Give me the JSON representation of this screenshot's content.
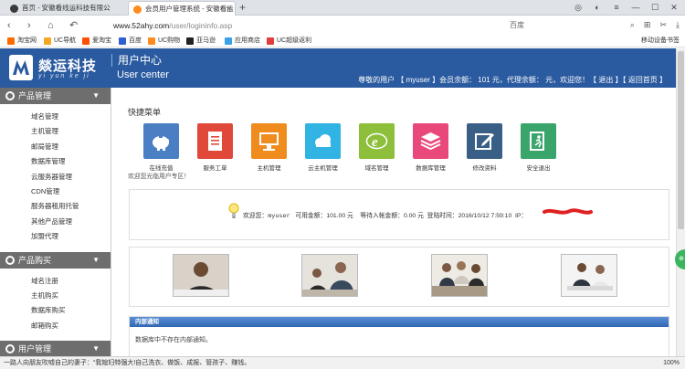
{
  "browser": {
    "tabs": [
      {
        "title": "首页 - 安徽看线运科技有限公",
        "favicon_color": "#3a3a3a",
        "active": false
      },
      {
        "title": "会员用户管理系统 - 安徽看运",
        "favicon_color": "#ff8a1f",
        "active": true
      }
    ],
    "new_tab": "+",
    "url_host": "www.52ahy.com",
    "url_path": "/user/logininfo.asp",
    "search_engine": "百度",
    "bookmarks": [
      {
        "label": "淘宝网",
        "color": "#ff6a00"
      },
      {
        "label": "UC导航",
        "color": "#f5a623"
      },
      {
        "label": "爱淘宝",
        "color": "#ff5000"
      },
      {
        "label": "百度",
        "color": "#2f5fd0"
      },
      {
        "label": "UC购物",
        "color": "#ff8a1f"
      },
      {
        "label": "亚马逊",
        "color": "#222222"
      },
      {
        "label": "应用商店",
        "color": "#3aa0e8"
      },
      {
        "label": "UC超级返利",
        "color": "#e23c3c"
      }
    ],
    "bookmark_right": "移动设备书签"
  },
  "header": {
    "logo_cn": "燚运科技",
    "logo_pinyin": "yi yun ke ji",
    "title": "用户中心",
    "subtitle": "User center",
    "welcome": "尊敬的用户 【 myuser 】会员余额： 101 元，代理余额： 元，欢迎您！【 退出 】【 返回首页 】"
  },
  "sidebar": {
    "sections": [
      {
        "title": "产品管理",
        "items": [
          "域名管理",
          "主机管理",
          "邮局管理",
          "数据库管理",
          "云服务器管理",
          "CDN管理",
          "服务器租用托管",
          "其他产品管理",
          "加盟代理"
        ]
      },
      {
        "title": "产品购买",
        "items": [
          "域名注册",
          "主机购买",
          "数据库购买",
          "邮箱购买"
        ]
      },
      {
        "title": "用户管理",
        "items": []
      }
    ]
  },
  "quick_menu": {
    "title": "快捷菜单",
    "items": [
      {
        "label": "在线充值",
        "icon": "piggy-bank-icon",
        "color": "#4a7fc4"
      },
      {
        "label": "服务工单",
        "icon": "document-icon",
        "color": "#e0493a"
      },
      {
        "label": "主机管理",
        "icon": "monitor-icon",
        "color": "#f08b1d"
      },
      {
        "label": "云主机管理",
        "icon": "cloud-icon",
        "color": "#31b3e3"
      },
      {
        "label": "域名管理",
        "icon": "e-logo-icon",
        "color": "#8dbf3a"
      },
      {
        "label": "数据库管理",
        "icon": "database-layers-icon",
        "color": "#e8497a"
      },
      {
        "label": "修改资料",
        "icon": "edit-icon",
        "color": "#3a5f86"
      },
      {
        "label": "安全退出",
        "icon": "exit-icon",
        "color": "#3aa56a"
      }
    ],
    "welcome": "欢迎您光临用户专区！"
  },
  "account_info": {
    "welcome_label": "欢迎您：",
    "username": "myuser",
    "balance_label": "可用金额：",
    "balance": "101.00 元",
    "pending_label": "等待入帐金额：",
    "pending": "0.00 元",
    "login_label": "登陆时间：",
    "login_time": "2016/10/12 7:59:10",
    "ip_label": "IP："
  },
  "notice": {
    "title": "内部通知",
    "body": "数据库中不存在内部通知。"
  },
  "status": {
    "text": "一路人向朋友吹嘘自己的妻子：“我媳妇特强大!自己洗衣、做饭、成报、管孩子、赚钱。",
    "zoom": "100%"
  }
}
